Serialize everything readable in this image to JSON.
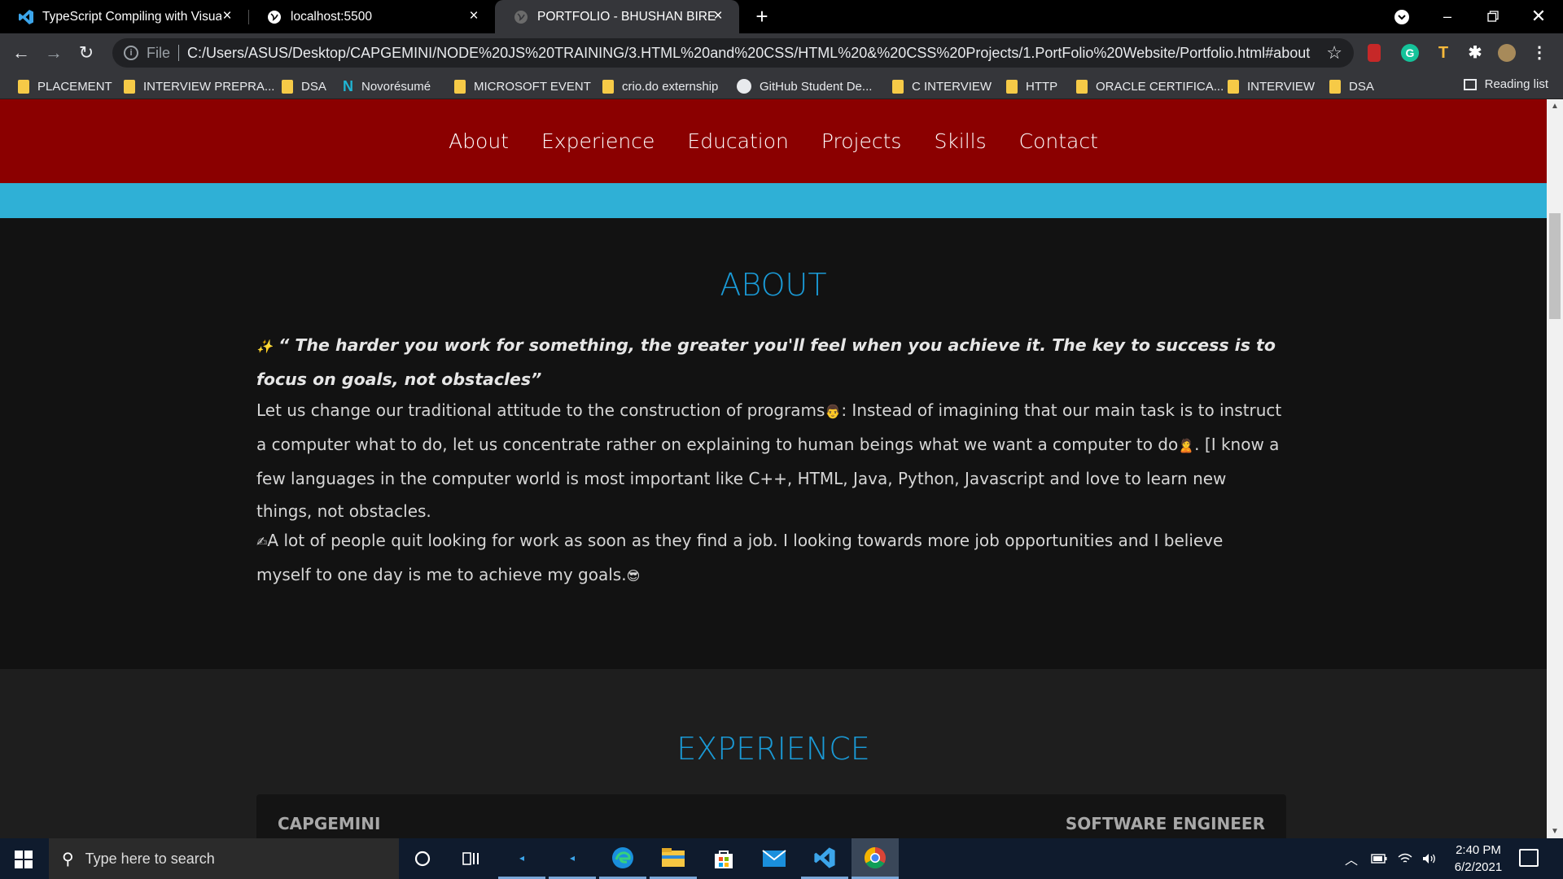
{
  "browser": {
    "tabs": [
      {
        "title": "TypeScript Compiling with Visual",
        "icon": "vscode-icon",
        "active": false
      },
      {
        "title": "localhost:5500",
        "icon": "globe-icon",
        "active": false
      },
      {
        "title": "PORTFOLIO - BHUSHAN BIRE",
        "icon": "globe-icon",
        "active": true
      }
    ],
    "new_tab": "+",
    "address": {
      "scheme_label": "File",
      "url": "C:/Users/ASUS/Desktop/CAPGEMINI/NODE%20JS%20TRAINING/3.HTML%20and%20CSS/HTML%20&%20CSS%20Projects/1.PortFolio%20Website/Portfolio.html#about"
    },
    "bookmarks": [
      {
        "label": "PLACEMENT",
        "type": "folder"
      },
      {
        "label": "INTERVIEW PREPRA...",
        "type": "folder"
      },
      {
        "label": "DSA",
        "type": "folder"
      },
      {
        "label": "Novorésumé",
        "type": "site"
      },
      {
        "label": "MICROSOFT EVENT",
        "type": "folder"
      },
      {
        "label": "crio.do externship",
        "type": "folder"
      },
      {
        "label": "GitHub Student De...",
        "type": "site"
      },
      {
        "label": "C INTERVIEW",
        "type": "folder"
      },
      {
        "label": "HTTP",
        "type": "folder"
      },
      {
        "label": "ORACLE CERTIFICA...",
        "type": "folder"
      },
      {
        "label": "INTERVIEW",
        "type": "folder"
      },
      {
        "label": "DSA",
        "type": "folder"
      }
    ],
    "reading_list": "Reading list"
  },
  "site": {
    "nav": [
      "About",
      "Experience",
      "Education",
      "Projects",
      "Skills",
      "Contact"
    ],
    "nav_color": "#8b0000",
    "strip_color": "#2fb0d6",
    "about": {
      "title": "ABOUT",
      "quote": "“ The harder you work for something, the greater you'll feel when you achieve it. The key to success is to focus on goals, not obstacles”",
      "para1_a": "Let us change our traditional attitude to the construction of programs",
      "para1_b": ": Instead of imagining that our main task is to instruct a computer what to do, let us concentrate rather on explaining to human beings what we want a computer to do",
      "para1_c": ". [I know a few languages in the computer world is most important like C++, HTML, Java, Python, Javascript and love to learn new things, not obstacles.",
      "para2": "A lot of people quit looking for work as soon as they find a job. I looking towards more job opportunities and I believe myself to one day is me to achieve my goals."
    },
    "experience": {
      "title": "EXPERIENCE",
      "company": "CAPGEMINI",
      "role": "SOFTWARE ENGINEER"
    },
    "accent_color": "#1a9ad6"
  },
  "taskbar": {
    "search_placeholder": "Type here to search",
    "time": "2:40 PM",
    "date": "6/2/2021"
  }
}
